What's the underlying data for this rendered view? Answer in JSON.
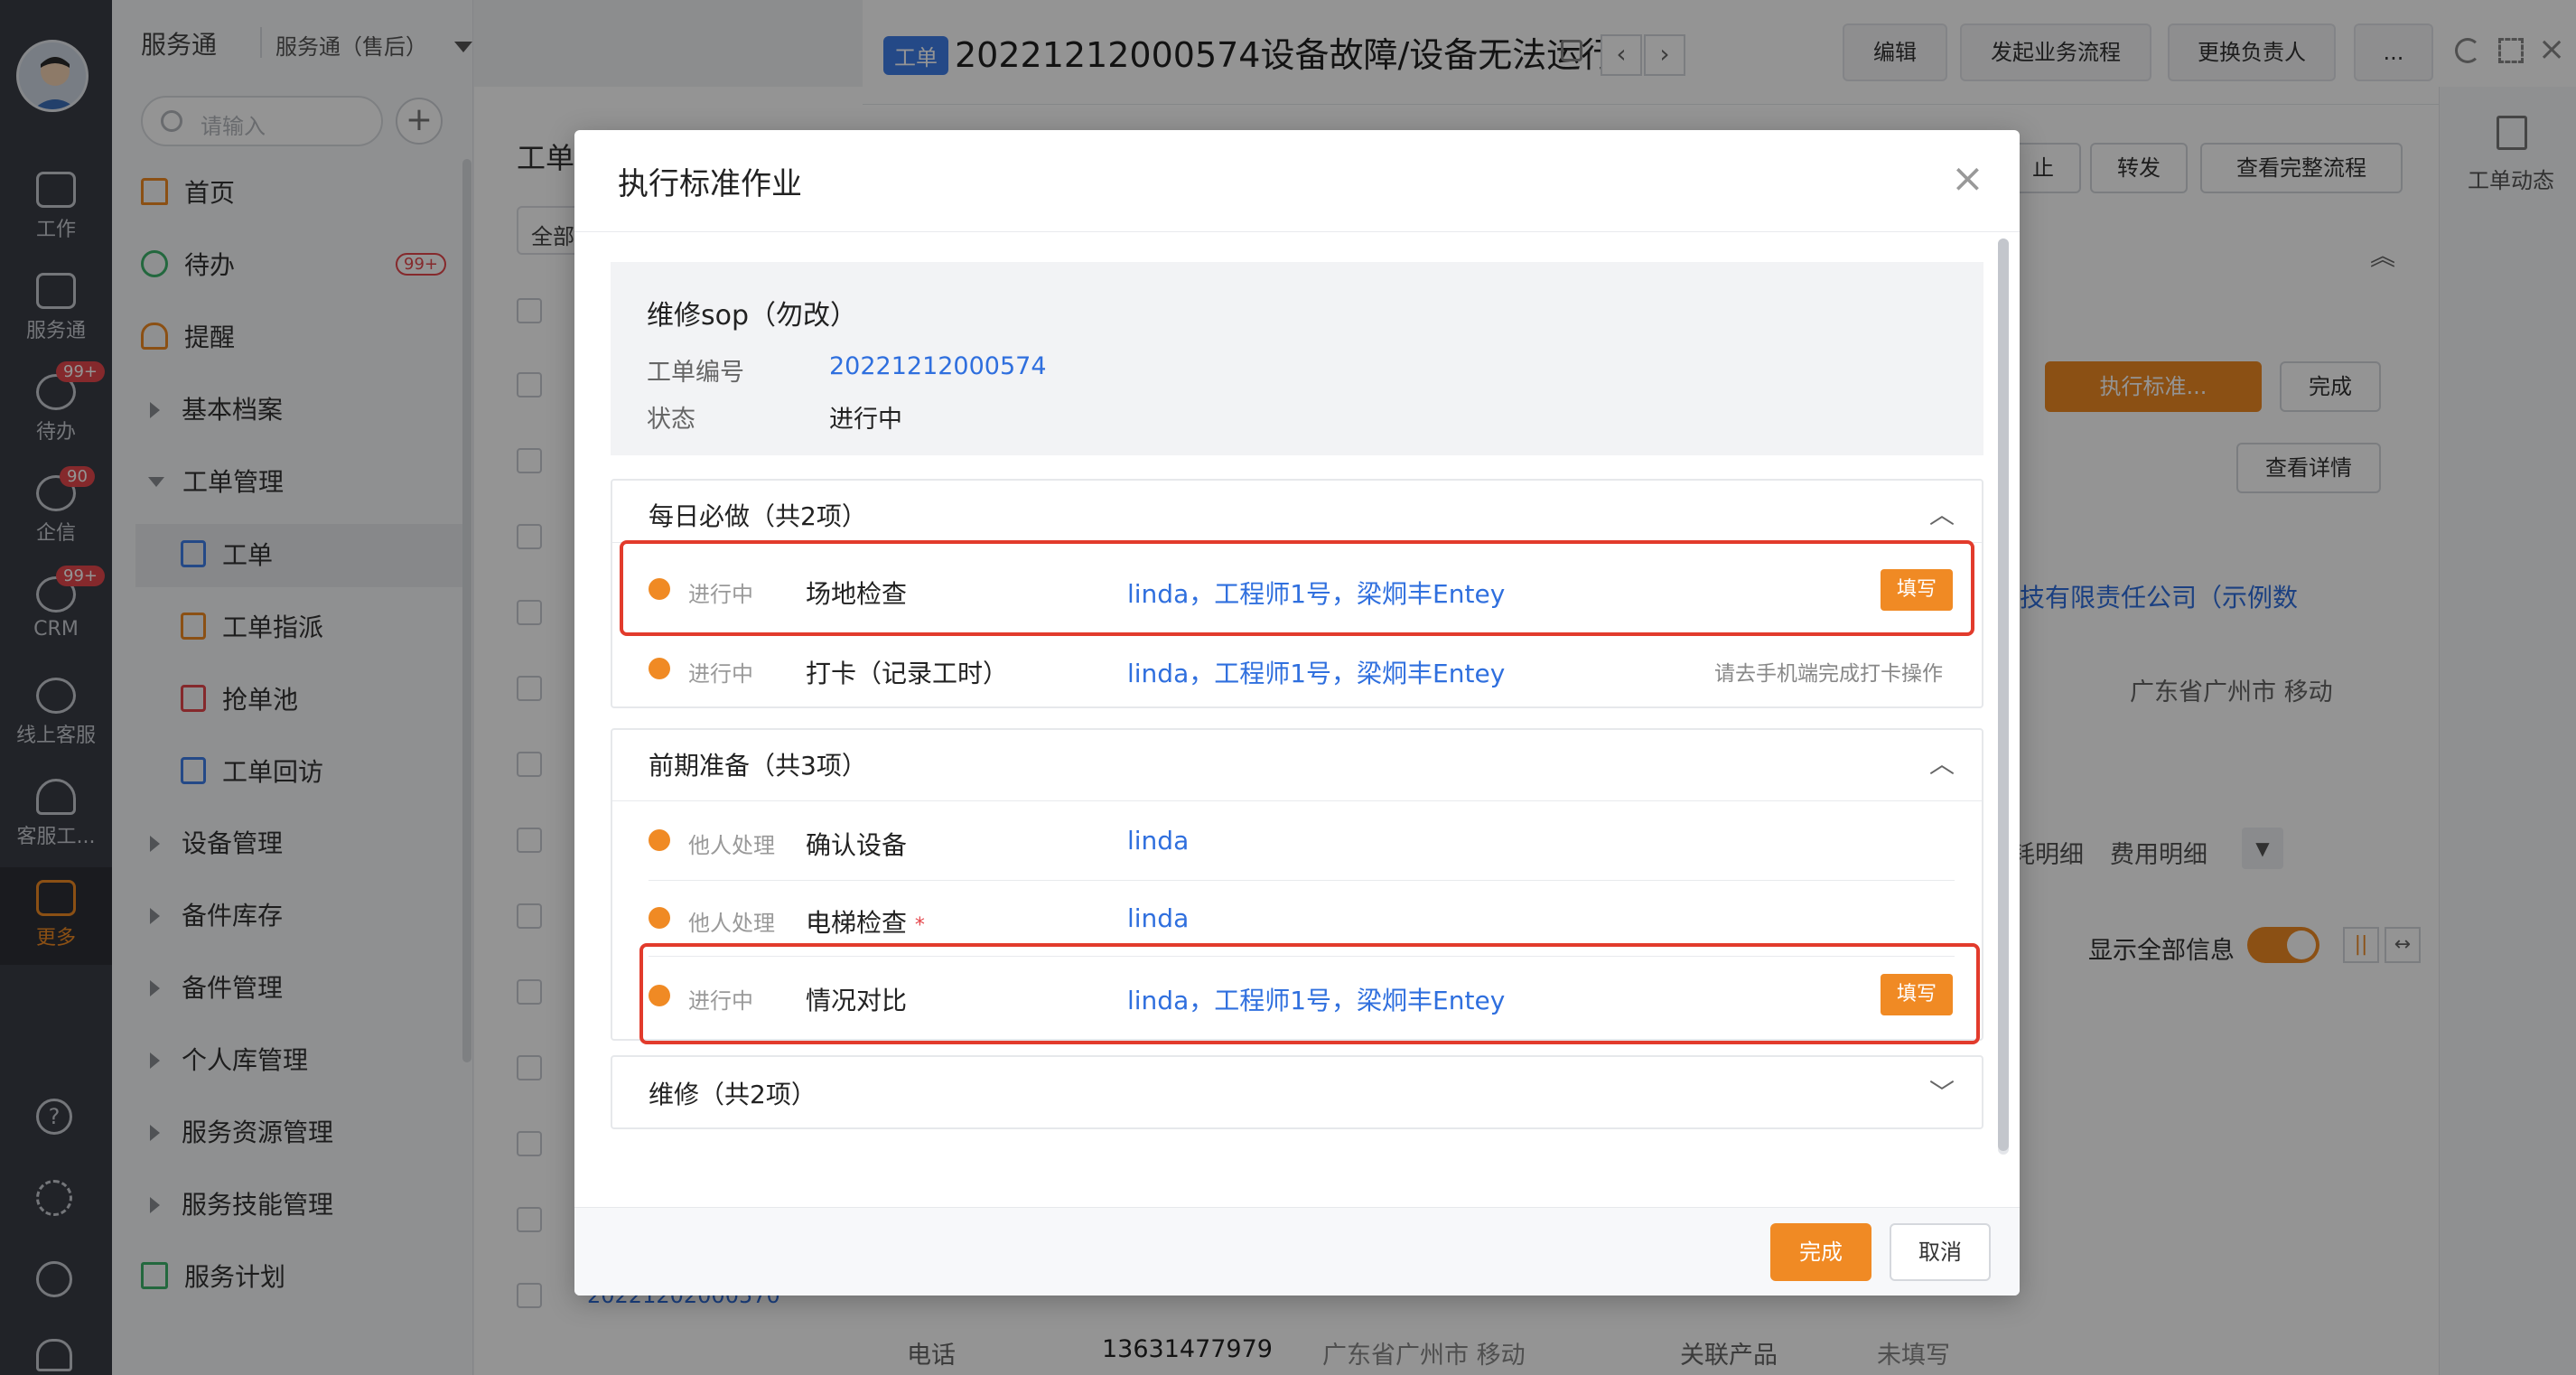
{
  "rail": {
    "items": [
      {
        "label": "工作",
        "icon": "briefcase-icon"
      },
      {
        "label": "服务通",
        "icon": "clipboard-icon"
      },
      {
        "label": "待办",
        "icon": "check-circle-icon",
        "badge": "99+"
      },
      {
        "label": "企信",
        "icon": "chat-icon",
        "badge": "90"
      },
      {
        "label": "CRM",
        "icon": "clock-icon",
        "badge": "99+"
      },
      {
        "label": "线上客服",
        "icon": "smile-icon"
      },
      {
        "label": "客服工...",
        "icon": "headset-icon"
      },
      {
        "label": "更多",
        "icon": "grid-icon"
      }
    ],
    "bottom_icons": [
      "help-icon",
      "settings-icon",
      "history-icon",
      "contacts-icon"
    ]
  },
  "sidebar": {
    "app_name": "服务通",
    "app_variant": "服务通（售后）",
    "search_placeholder": "请输入",
    "menu": [
      {
        "label": "首页",
        "icon": "home-icon"
      },
      {
        "label": "待办",
        "icon": "check-icon",
        "badge": "99+"
      },
      {
        "label": "提醒",
        "icon": "bell-icon"
      },
      {
        "label": "基本档案",
        "collapsed": true
      },
      {
        "label": "工单管理",
        "expanded": true
      },
      {
        "label": "设备管理",
        "collapsed": true
      },
      {
        "label": "备件库存",
        "collapsed": true
      },
      {
        "label": "备件管理",
        "collapsed": true
      },
      {
        "label": "个人库管理",
        "collapsed": true
      },
      {
        "label": "服务资源管理",
        "collapsed": true
      },
      {
        "label": "服务技能管理",
        "collapsed": true
      },
      {
        "label": "服务计划",
        "icon": "list-icon"
      }
    ],
    "sub_menu": [
      {
        "label": "工单",
        "active": true
      },
      {
        "label": "工单指派"
      },
      {
        "label": "抢单池"
      },
      {
        "label": "工单回访"
      }
    ]
  },
  "list": {
    "title": "工单",
    "filter": "全部",
    "footer_number": "20221202000570"
  },
  "detail": {
    "tag": "工单",
    "title": "20221212000574设备故障/设备无法运行",
    "buttons": [
      "编辑",
      "发起业务流程",
      "更换负责人",
      "..."
    ],
    "action_buttons": [
      "止",
      "转发",
      "查看完整流程"
    ],
    "exec_button": "执行标准...",
    "done_button": "完成",
    "view_detail": "查看详情",
    "company": "技有限责任公司（示例数",
    "region": "广东省广州市 移动",
    "tabs": [
      "耗明细",
      "费用明细"
    ],
    "show_all_label": "显示全部信息",
    "side_tab": "工单动态",
    "bottom_row": {
      "phone_label": "电话",
      "phone": "13631477979",
      "location": "广东省广州市 移动",
      "product_label": "关联产品",
      "product_value": "未填写"
    }
  },
  "modal": {
    "title": "执行标准作业",
    "sop_name": "维修sop（勿改）",
    "ticket_no_label": "工单编号",
    "ticket_no": "20221212000574",
    "status_label": "状态",
    "status_value": "进行中",
    "sections": [
      {
        "title": "每日必做（共2项）",
        "expanded": true,
        "rows": [
          {
            "status": "进行中",
            "name": "场地检查",
            "assignees": "linda，工程师1号，梁炯丰Entey",
            "action": "填写",
            "highlighted": true
          },
          {
            "status": "进行中",
            "name": "打卡（记录工时）",
            "assignees": "linda，工程师1号，梁炯丰Entey",
            "hint": "请去手机端完成打卡操作"
          }
        ]
      },
      {
        "title": "前期准备（共3项）",
        "expanded": true,
        "rows": [
          {
            "status": "他人处理",
            "name": "确认设备",
            "assignees": "linda"
          },
          {
            "status": "他人处理",
            "name": "电梯检查",
            "required": "*",
            "assignees": "linda"
          },
          {
            "status": "进行中",
            "name": "情况对比",
            "assignees": "linda，工程师1号，梁炯丰Entey",
            "action": "填写",
            "highlighted": true
          }
        ]
      },
      {
        "title": "维修（共2项）",
        "expanded": false,
        "rows": []
      }
    ],
    "confirm_button": "完成",
    "cancel_button": "取消"
  },
  "colors": {
    "accent": "#f08a24",
    "link": "#2f6fde",
    "highlight": "#e23b2c",
    "rail_bg": "#3a3d46",
    "badge": "#e5484d"
  }
}
